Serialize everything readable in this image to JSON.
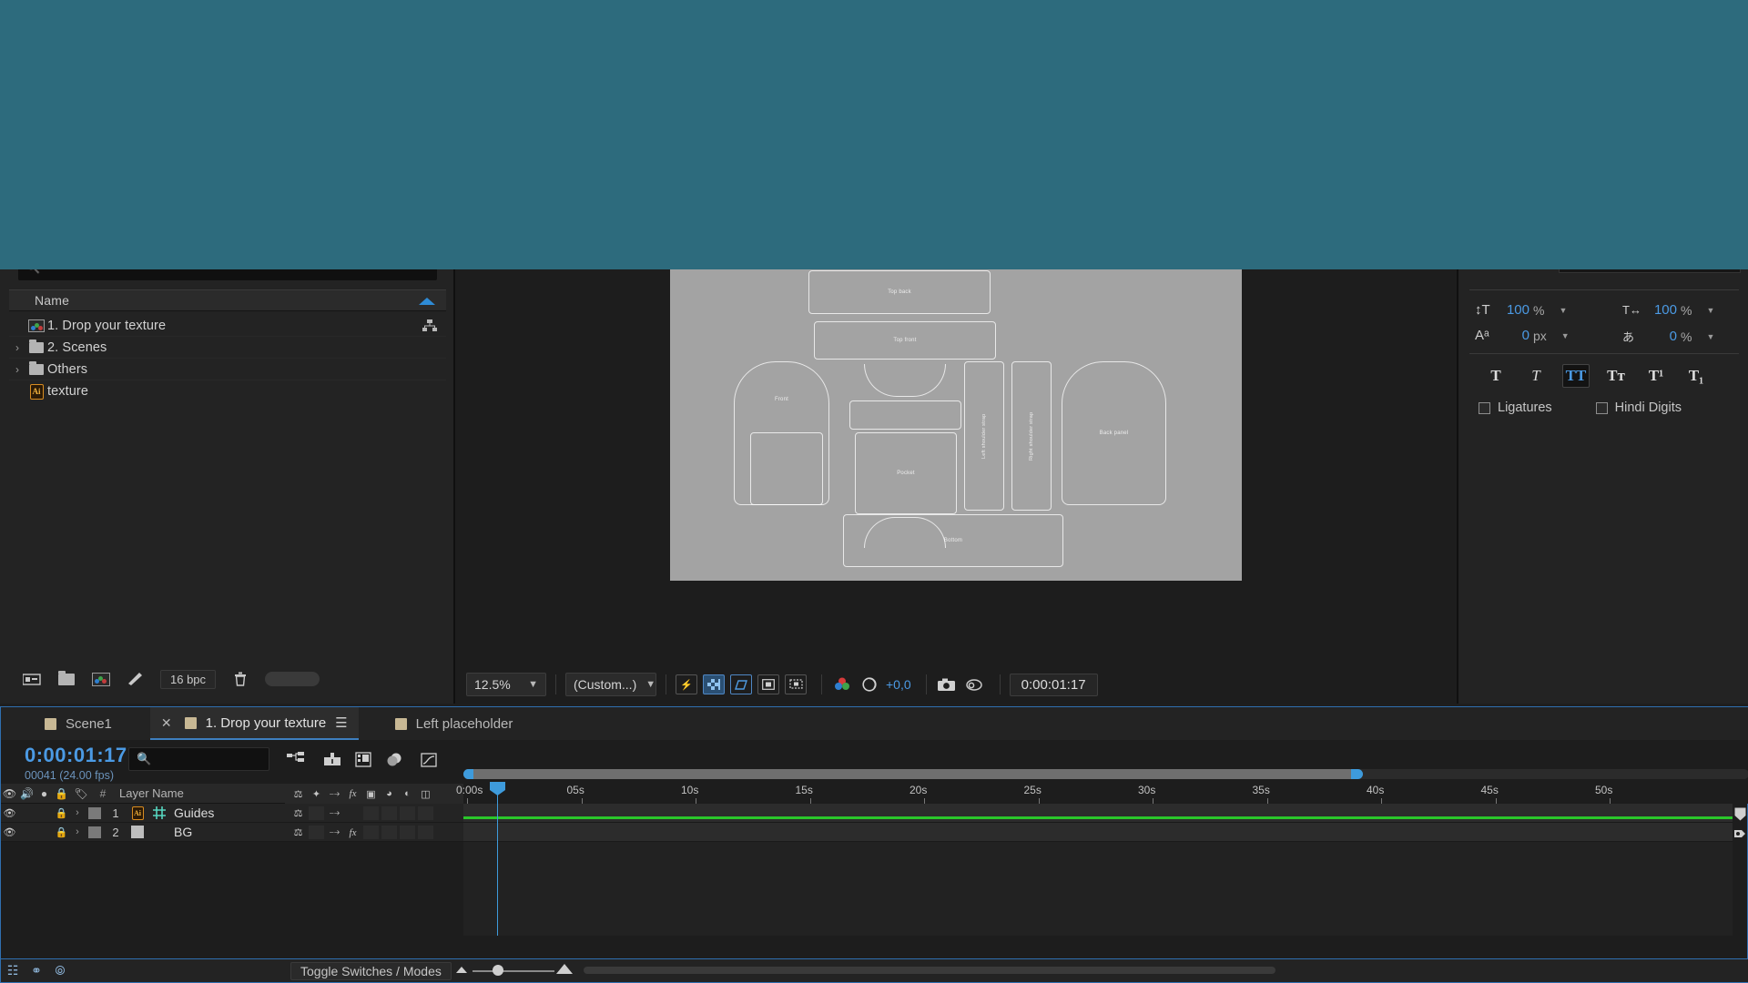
{
  "project": {
    "search_placeholder": "",
    "column_header": "Name",
    "items": [
      {
        "label": "1. Drop your texture",
        "type": "composition",
        "expandable": false
      },
      {
        "label": "2. Scenes",
        "type": "folder",
        "expandable": true
      },
      {
        "label": "Others",
        "type": "folder",
        "expandable": true
      },
      {
        "label": "texture",
        "type": "illustrator",
        "expandable": false
      }
    ],
    "footer": {
      "bit_depth": "16 bpc",
      "icons": [
        "interpret-footage-icon",
        "new-folder-icon",
        "new-composition-icon",
        "project-settings-icon",
        "delete-icon"
      ]
    }
  },
  "comp_viewer": {
    "magnification": "12.5%",
    "resolution": "(Custom...)",
    "exposure_offset": "+0,0",
    "timecode": "0:00:01:17",
    "toolbar_icons": [
      "fast-previews-icon",
      "transparency-grid-icon",
      "region-of-interest-icon",
      "mask-paths-icon",
      "proportional-grid-icon",
      "channel-icon",
      "exposure-icon",
      "snapshot-icon",
      "show-snapshot-icon"
    ],
    "pattern_labels": {
      "top_back": "Top back",
      "top_front": "Top front",
      "front": "Front",
      "pocket": "Pocket",
      "left_strap": "Left shoulder strap",
      "right_strap": "Right shoulder strap",
      "back_panel": "Back panel",
      "bottom": "Bottom"
    }
  },
  "character_panel": {
    "px_label": "px",
    "vertical_scale": {
      "value": "100",
      "unit": "%"
    },
    "horizontal_scale": {
      "value": "100",
      "unit": "%"
    },
    "baseline_shift": {
      "value": "0",
      "unit": "px"
    },
    "tsume": {
      "value": "0",
      "unit": "%"
    },
    "style_buttons": [
      {
        "name": "bold",
        "glyph": "T",
        "active": false
      },
      {
        "name": "italic",
        "glyph": "T",
        "active": false
      },
      {
        "name": "all-caps",
        "glyph": "TT",
        "active": true
      },
      {
        "name": "small-caps",
        "glyph": "Tᴛ",
        "active": false
      },
      {
        "name": "superscript",
        "glyph": "T¹",
        "active": false
      },
      {
        "name": "subscript",
        "glyph": "T₁",
        "active": false
      }
    ],
    "ligatures_label": "Ligatures",
    "hindi_digits_label": "Hindi Digits"
  },
  "timeline": {
    "tabs": [
      {
        "label": "Scene1",
        "active": false,
        "closable": false
      },
      {
        "label": "1. Drop your texture",
        "active": true,
        "closable": true
      },
      {
        "label": "Left placeholder",
        "active": false,
        "closable": false
      }
    ],
    "current_time": "0:00:01:17",
    "frame_info": "00041 (24.00 fps)",
    "search_placeholder": "",
    "column_headers": {
      "hash": "#",
      "layer_name": "Layer Name"
    },
    "layers": [
      {
        "number": "1",
        "name": "Guides",
        "type": "illustrator-grid",
        "has_fx": false
      },
      {
        "number": "2",
        "name": "BG",
        "type": "solid",
        "has_fx": true
      }
    ],
    "ruler_ticks": [
      "0:00s",
      "05s",
      "10s",
      "15s",
      "20s",
      "25s",
      "30s",
      "35s",
      "40s",
      "45s",
      "50s"
    ],
    "footer": {
      "toggle_label": "Toggle Switches / Modes"
    }
  },
  "colors": {
    "accent_blue": "#3e9bdc",
    "value_blue": "#4b9ae4",
    "teal_overlay": "#2d6b7d",
    "panel_bg": "#1d1d1d",
    "green_bar": "#2ac72a",
    "tab_swatch": "#c8b894"
  }
}
